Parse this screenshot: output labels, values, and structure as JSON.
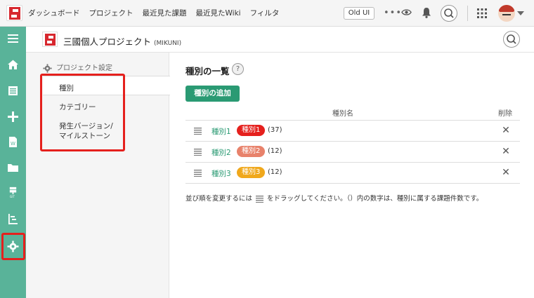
{
  "colors": {
    "accent": "#2a9a73",
    "rail": "#59b399",
    "highlight": "#e5201d"
  },
  "topnav": {
    "items": [
      "ダッシュボード",
      "プロジェクト",
      "最近見た課題",
      "最近見たWiki",
      "フィルタ"
    ],
    "old_ui": "Old UI"
  },
  "project": {
    "name": "三國個人プロジェクト",
    "key": "(MIKUNI)"
  },
  "settings": {
    "heading": "プロジェクト設定",
    "items": [
      "種別",
      "カテゴリー",
      "発生バージョン/",
      "マイルストーン"
    ]
  },
  "main": {
    "title": "種別の一覧",
    "help": "?",
    "add_button": "種別の追加",
    "col_name": "種別名",
    "col_delete": "削除",
    "rows": [
      {
        "name": "種別1",
        "badge": "種別1",
        "badge_color": "#e5201d",
        "count": "(37)"
      },
      {
        "name": "種別2",
        "badge": "種別2",
        "badge_color": "#e8826b",
        "count": "(12)"
      },
      {
        "name": "種別3",
        "badge": "種別3",
        "badge_color": "#f0a81c",
        "count": "(12)"
      }
    ],
    "delete_glyph": "✕",
    "footnote_a": "並び順を変更するには",
    "footnote_b": "をドラッグしてください。（）内の数字は、種別に属する課題件数です。"
  }
}
